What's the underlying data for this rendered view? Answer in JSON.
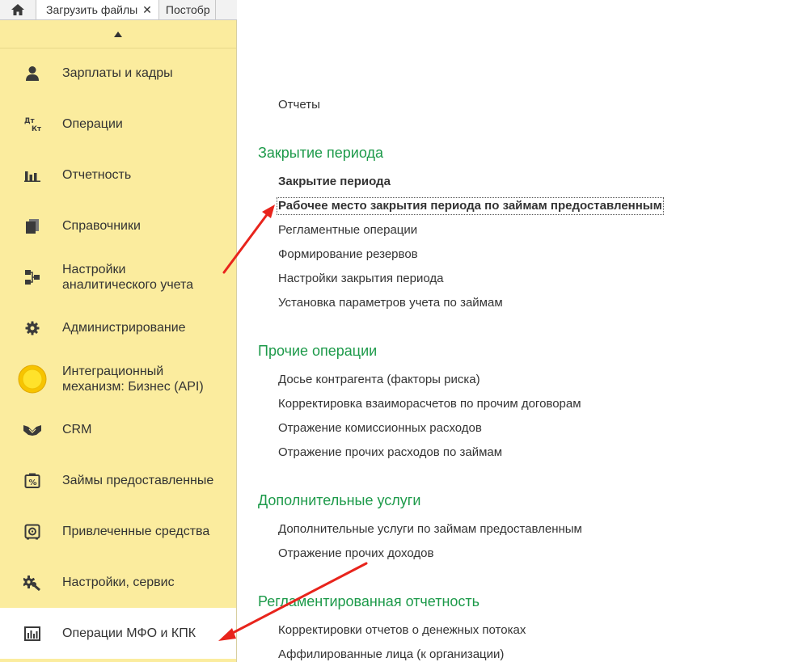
{
  "tabs": {
    "home_icon": "home-icon",
    "active_label": "Загрузить файлы",
    "close_glyph": "✕",
    "next_label": "Постобр"
  },
  "sidebar": {
    "items": [
      {
        "name": "salary",
        "label": "Зарплаты и кадры",
        "icon": "person-icon"
      },
      {
        "name": "operations",
        "label": "Операции",
        "icon": "dt-kt-icon"
      },
      {
        "name": "reporting",
        "label": "Отчетность",
        "icon": "bar-chart-icon"
      },
      {
        "name": "directories",
        "label": "Справочники",
        "icon": "books-icon"
      },
      {
        "name": "analytics-settings",
        "label1": "Настройки",
        "label2": "аналитического учета",
        "icon": "hierarchy-icon"
      },
      {
        "name": "administration",
        "label": "Администрирование",
        "icon": "gear-icon"
      },
      {
        "name": "integration",
        "label1": "Интеграционный",
        "label2": "механизм: Бизнес (API)",
        "icon": "circle-icon"
      },
      {
        "name": "crm",
        "label": "CRM",
        "icon": "handshake-icon"
      },
      {
        "name": "loans",
        "label": "Займы предоставленные",
        "icon": "loan-icon"
      },
      {
        "name": "attracted",
        "label": "Привлеченные средства",
        "icon": "safe-icon"
      },
      {
        "name": "settings-service",
        "label": "Настройки, сервис",
        "icon": "wrench-gear-icon"
      },
      {
        "name": "mfo-operations",
        "label": "Операции МФО и КПК",
        "icon": "monitor-chart-icon"
      }
    ]
  },
  "content": {
    "reports_link": "Отчеты",
    "sections": [
      {
        "title": "Закрытие периода",
        "links": [
          "Закрытие периода",
          "Рабочее место закрытия периода по займам предоставленным",
          "Регламентные операции",
          "Формирование резервов",
          "Настройки закрытия периода",
          "Установка параметров учета по займам"
        ]
      },
      {
        "title": "Прочие операции",
        "links": [
          "Досье контрагента (факторы риска)",
          "Корректировка взаиморасчетов по прочим договорам",
          "Отражение комиссионных расходов",
          "Отражение прочих расходов по займам"
        ]
      },
      {
        "title": "Дополнительные услуги",
        "links": [
          "Дополнительные услуги по займам предоставленным",
          "Отражение прочих доходов"
        ]
      },
      {
        "title": "Регламентированная отчетность",
        "links": [
          "Корректировки отчетов о денежных потоках",
          "Аффилированные лица (к организации)"
        ]
      }
    ]
  },
  "colors": {
    "sidebar_bg": "#fbec9e",
    "section_title": "#1d9a4a",
    "annotation_arrow": "#e8241c"
  }
}
